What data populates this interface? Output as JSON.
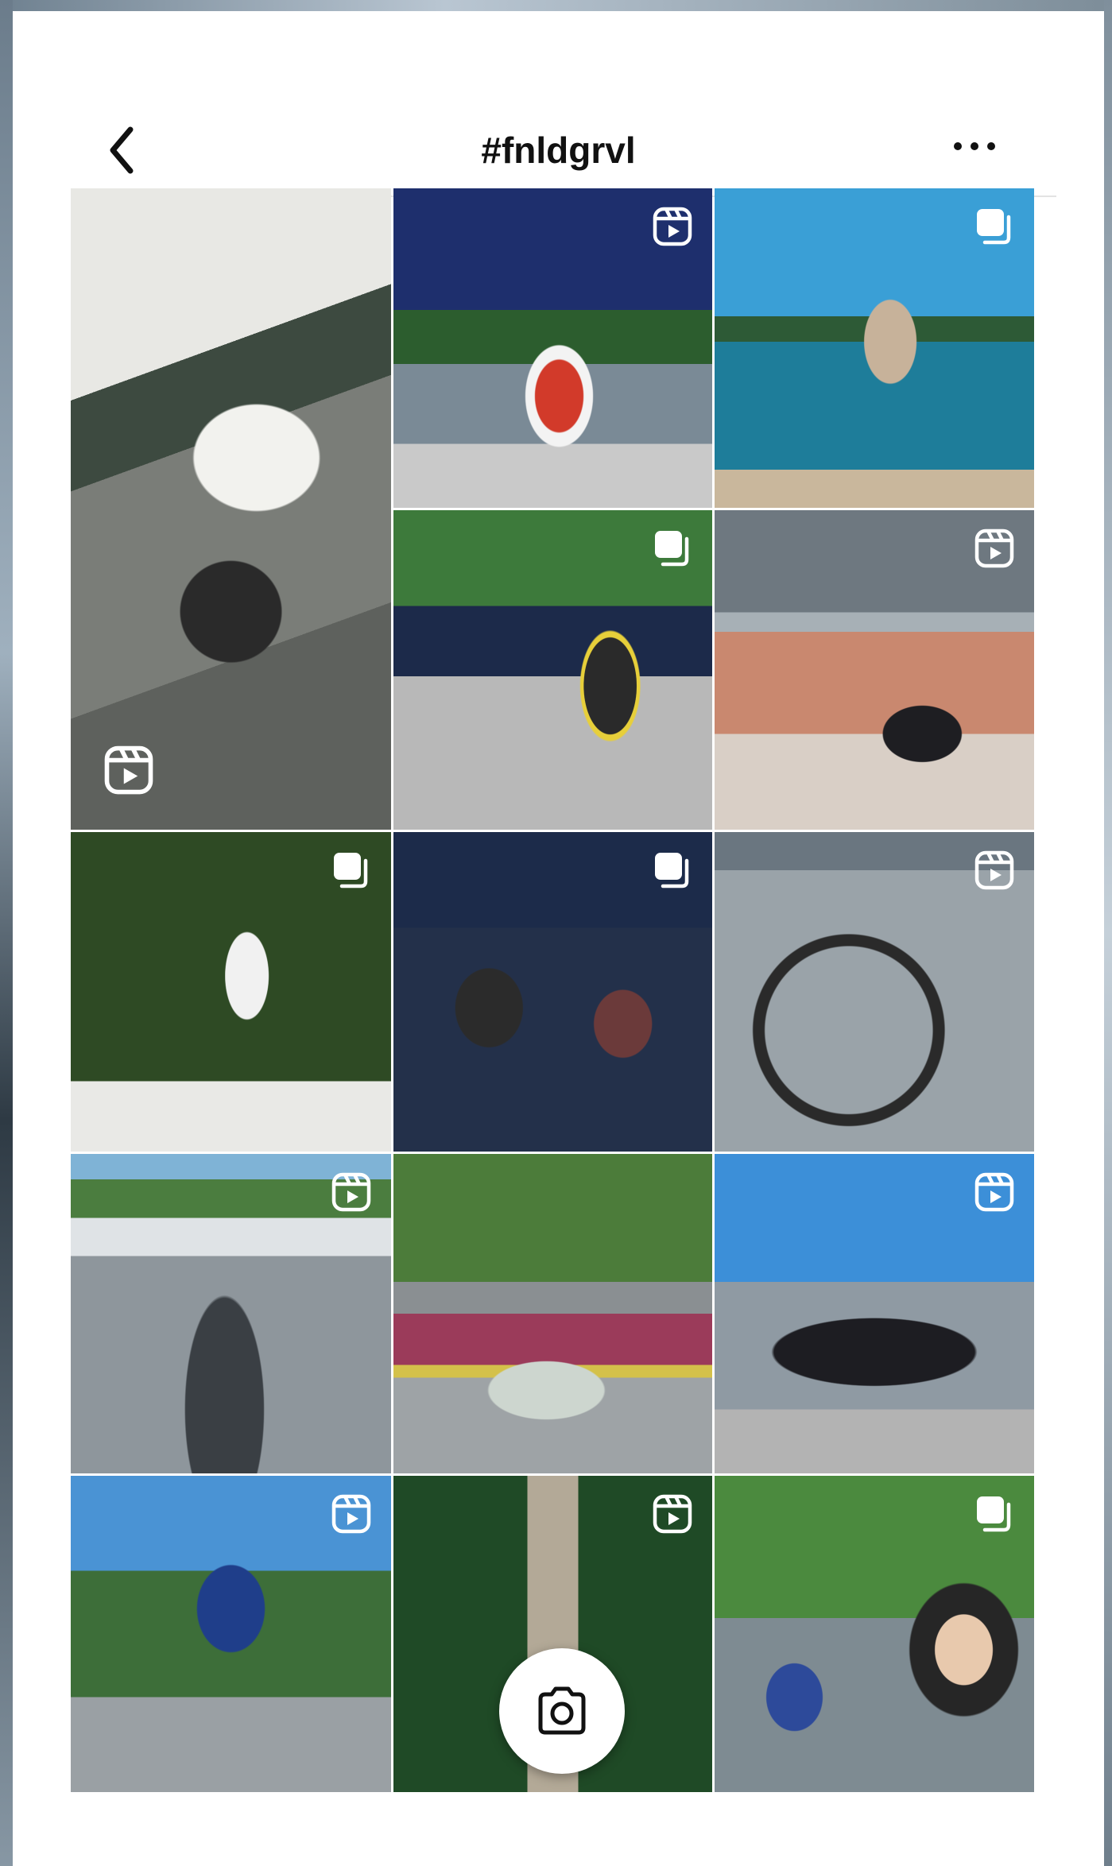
{
  "header": {
    "title": "#fnldgrvl",
    "back_icon": "chevron-left-icon",
    "more_icon": "ellipsis-icon"
  },
  "grid": {
    "tiles": [
      {
        "index": 1,
        "badge": "reel-icon",
        "layout": "tall"
      },
      {
        "index": 2,
        "badge": "reel-icon"
      },
      {
        "index": 3,
        "badge": "carousel-icon"
      },
      {
        "index": 4,
        "badge": "carousel-icon"
      },
      {
        "index": 5,
        "badge": "reel-icon"
      },
      {
        "index": 6,
        "badge": "carousel-icon"
      },
      {
        "index": 7,
        "badge": "carousel-icon"
      },
      {
        "index": 8,
        "badge": "reel-icon"
      },
      {
        "index": 9,
        "badge": "reel-icon"
      },
      {
        "index": 10,
        "badge": "none"
      },
      {
        "index": 11,
        "badge": "reel-icon"
      },
      {
        "index": 12,
        "badge": "reel-icon"
      },
      {
        "index": 13,
        "badge": "reel-icon"
      },
      {
        "index": 14,
        "badge": "carousel-icon"
      }
    ]
  },
  "fab": {
    "icon": "camera-icon"
  },
  "colors": {
    "background": "#ffffff",
    "text": "#111111",
    "divider": "#e3e3e3"
  }
}
